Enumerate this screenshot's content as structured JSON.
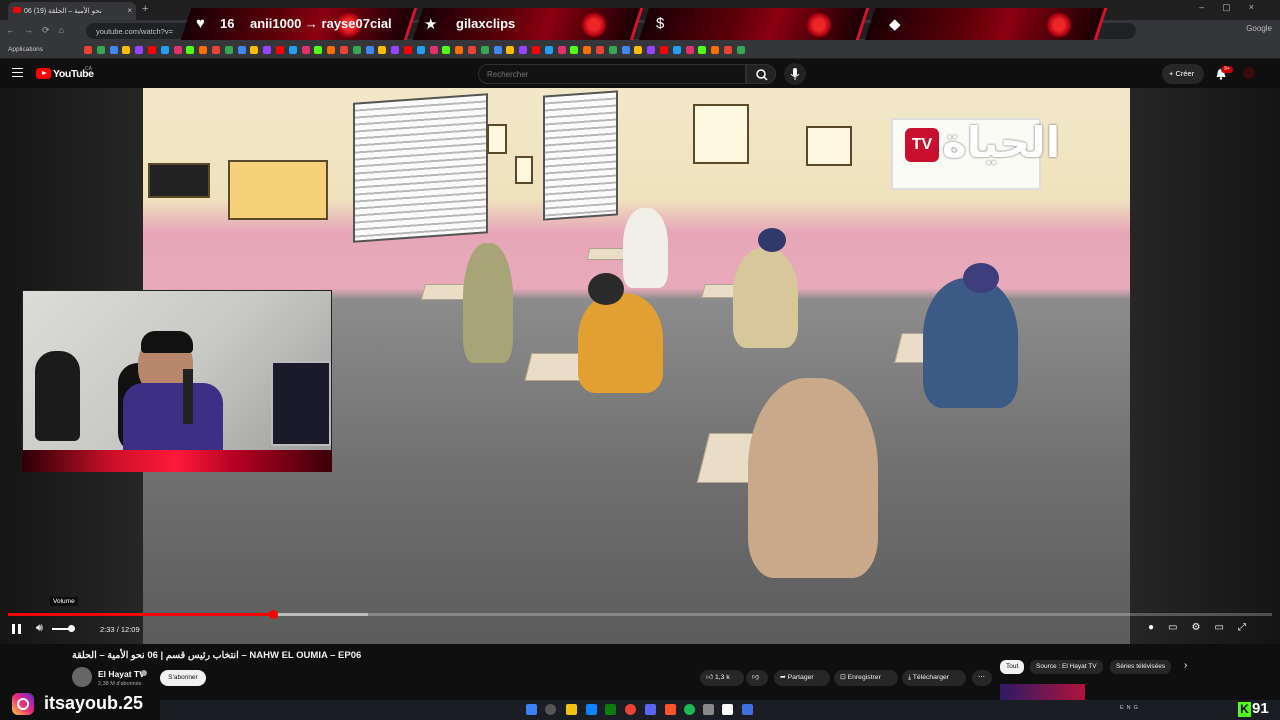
{
  "browser": {
    "tab_title": "06 نحو الأمية – الحلقة (19)",
    "url": "youtube.com/watch?v=",
    "bookmarks_label": "Applications",
    "google_label": "Google"
  },
  "overlay": {
    "heart_count": "16",
    "follow_text": "anii1000 → rayse07cial",
    "clips_text": "gilaxclips"
  },
  "youtube": {
    "brand": "YouTube",
    "region": "CA",
    "search_placeholder": "Rechercher",
    "create_label": "Créer",
    "notif_badge": "9+"
  },
  "video": {
    "channel_logo_tv": "TV",
    "channel_logo_ar": "الحياة",
    "volume_tooltip": "Volume",
    "current_time": "2:33",
    "duration": "12:09",
    "progress": 0.21,
    "buffered": 0.285,
    "volume_level": 0.85,
    "title": "انتخاب رئيس قسم | 06 نحو الأمية – الحلقة – NAHW EL OUMIA – EP06"
  },
  "channel": {
    "name": "El Hayat TV",
    "subscribers": "2,38 M d'abonnés",
    "subscribe_label": "S'abonner"
  },
  "actions": {
    "likes": "1,3 k",
    "share": "Partager",
    "save": "Enregistrer",
    "download": "Télécharger"
  },
  "chips": {
    "all": "Tout",
    "source": "Source : El Hayat TV",
    "series": "Séries télévisées"
  },
  "streamer": {
    "instagram_handle": "itsayoub.25",
    "kick_count": "91"
  },
  "taskbar": {
    "lang": "ENG"
  },
  "colors": {
    "accent": "#ff0000",
    "overlay_red": "#e0102a",
    "kick_green": "#53fc18"
  }
}
